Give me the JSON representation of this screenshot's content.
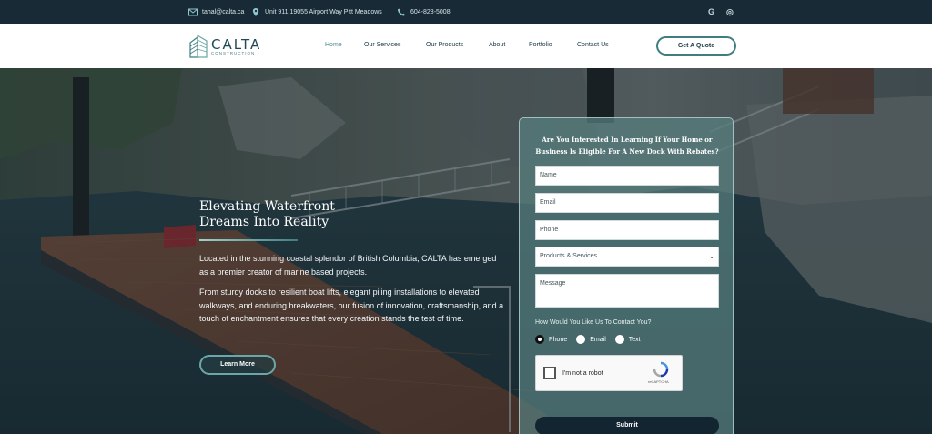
{
  "topbar": {
    "email": "tahal@calta.ca",
    "address": "Unit 911 19055 Airport Way Pitt Meadows",
    "phone": "604-828-5008",
    "social": [
      "G",
      "◎"
    ]
  },
  "brand": {
    "name": "CALTA",
    "tagline": "CONSTRUCTION"
  },
  "nav": {
    "items": [
      "Home",
      "Our Services",
      "Our Products",
      "About",
      "Portfolio",
      "Contact Us"
    ],
    "active": "Home",
    "cta": "Get A Quote"
  },
  "hero": {
    "title_line1": "Elevating Waterfront",
    "title_line2": "Dreams Into Reality",
    "para1": "Located in the stunning coastal splendor of British Columbia, CALTA has emerged as a premier creator of marine based projects.",
    "para2": "From sturdy docks to resilient boat lifts, elegant piling installations to elevated walkways, and enduring breakwaters, our fusion of innovation, craftsmanship, and a touch of enchantment ensures that every creation stands the test of time.",
    "learn_more": "Learn More"
  },
  "form": {
    "title_line1": "Are You Interested In Learning If Your Home or",
    "title_line2": "Business Is Eligible For A New Dock With Rebates?",
    "name_placeholder": "Name",
    "email_placeholder": "Email",
    "phone_placeholder": "Phone",
    "select_value": "Products & Services",
    "message_placeholder": "Message",
    "contact_question": "How Would You Like Us To Contact You?",
    "contact_options": [
      "Phone",
      "Email",
      "Text"
    ],
    "contact_selected": "Phone",
    "recaptcha_label": "I'm not a robot",
    "recaptcha_brand": "reCAPTCHA",
    "submit": "Submit"
  },
  "colors": {
    "topbar": "#172a36",
    "accent": "#3f7d7f",
    "panel": "#58807f",
    "submit": "#122530"
  }
}
